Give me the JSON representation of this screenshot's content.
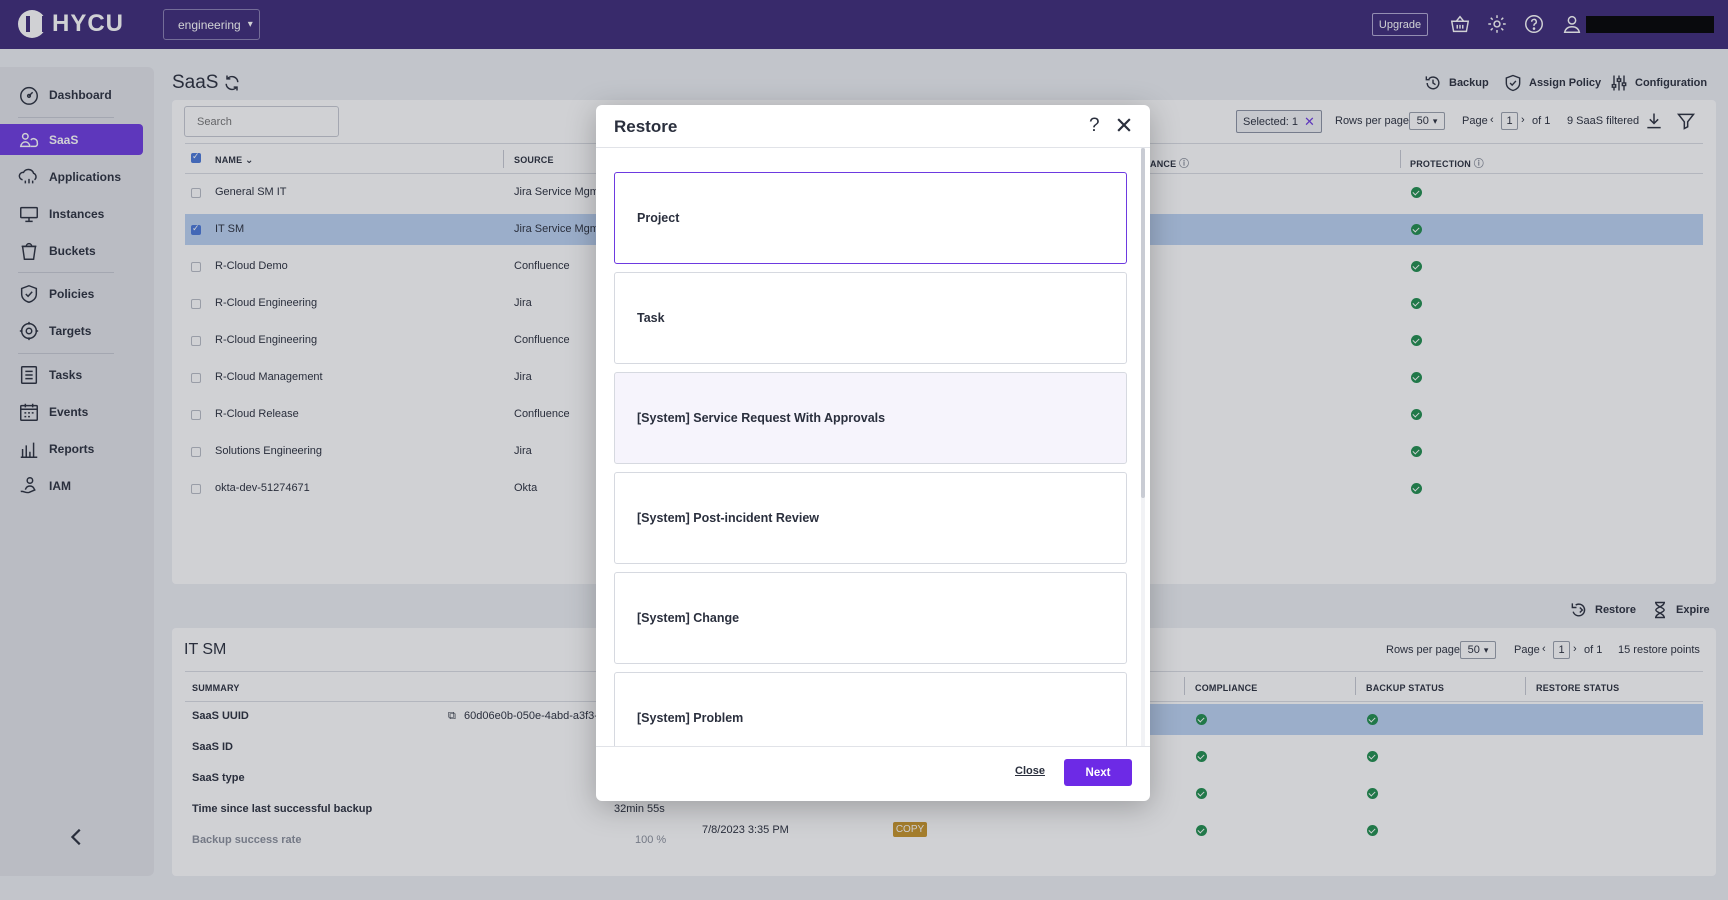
{
  "brand": {
    "name": "HYCU"
  },
  "topbar": {
    "tenant": "engineering",
    "upgrade_label": "Upgrade",
    "icons": [
      "basket-icon",
      "gear-icon",
      "help-icon",
      "user-icon"
    ]
  },
  "sidebar": {
    "items": [
      {
        "label": "Dashboard",
        "icon": "dashboard-icon"
      },
      {
        "label": "SaaS",
        "icon": "saas-icon",
        "active": true
      },
      {
        "label": "Applications",
        "icon": "applications-icon"
      },
      {
        "label": "Instances",
        "icon": "instances-icon"
      },
      {
        "label": "Buckets",
        "icon": "buckets-icon"
      },
      {
        "label": "Policies",
        "icon": "policies-icon"
      },
      {
        "label": "Targets",
        "icon": "targets-icon"
      },
      {
        "label": "Tasks",
        "icon": "tasks-icon"
      },
      {
        "label": "Events",
        "icon": "events-icon"
      },
      {
        "label": "Reports",
        "icon": "reports-icon"
      },
      {
        "label": "IAM",
        "icon": "iam-icon"
      }
    ]
  },
  "page": {
    "title": "SaaS",
    "actions": {
      "backup": "Backup",
      "assign_policy": "Assign Policy",
      "configuration": "Configuration"
    },
    "search_placeholder": "Search",
    "selected_label": "Selected: 1",
    "rows_per_page_label": "Rows per page",
    "rows_per_page": "50",
    "page_label": "Page",
    "page_current": "1",
    "page_of": "of 1",
    "filtered": "9 SaaS filtered"
  },
  "saas_table": {
    "columns": [
      "NAME",
      "SOURCE",
      "ANCE",
      "PROTECTION"
    ],
    "rows": [
      {
        "name": "General SM IT",
        "source": "Jira Service Mgm"
      },
      {
        "name": "IT SM",
        "source": "Jira Service Mgm",
        "selected": true
      },
      {
        "name": "R-Cloud Demo",
        "source": "Confluence"
      },
      {
        "name": "R-Cloud Engineering",
        "source": "Jira"
      },
      {
        "name": "R-Cloud Engineering",
        "source": "Confluence"
      },
      {
        "name": "R-Cloud Management",
        "source": "Jira"
      },
      {
        "name": "R-Cloud Release",
        "source": "Confluence"
      },
      {
        "name": "Solutions Engineering",
        "source": "Jira"
      },
      {
        "name": "okta-dev-51274671",
        "source": "Okta"
      }
    ]
  },
  "detail": {
    "title": "IT SM",
    "actions": {
      "restore": "Restore",
      "expire": "Expire"
    },
    "rows_per_page_label": "Rows per page",
    "rows_per_page": "50",
    "page_label": "Page",
    "page_current": "1",
    "page_of": "of 1",
    "restore_points": "15 restore points",
    "summary_header": "SUMMARY",
    "summary": [
      {
        "label": "SaaS UUID",
        "value": "60d06e0b-050e-4abd-a3f3-"
      },
      {
        "label": "SaaS ID",
        "value": ""
      },
      {
        "label": "SaaS type",
        "value": ""
      },
      {
        "label": "Time since last successful backup",
        "value": "32min 55s"
      },
      {
        "label": "Backup success rate",
        "value": "100 %"
      }
    ],
    "columns": [
      "COMPLIANCE",
      "BACKUP STATUS",
      "RESTORE STATUS"
    ],
    "last_row_date": "7/8/2023 3:35 PM",
    "copy_badge": "COPY"
  },
  "modal": {
    "title": "Restore",
    "help": "?",
    "options": [
      "Project",
      "Task",
      "[System] Service Request With Approvals",
      "[System] Post-incident Review",
      "[System] Change",
      "[System] Problem"
    ],
    "close_label": "Close",
    "next_label": "Next"
  }
}
